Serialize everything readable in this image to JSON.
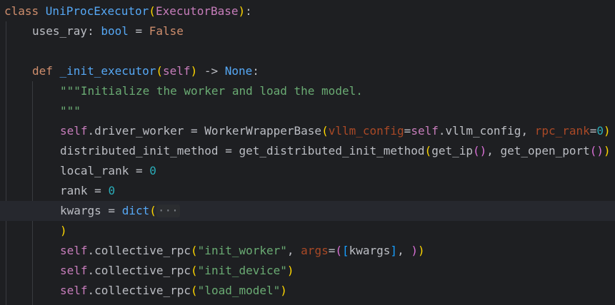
{
  "editor": {
    "lines": [
      [
        {
          "t": "class ",
          "c": "kw"
        },
        {
          "t": "UniProcExecutor",
          "c": "cls"
        },
        {
          "t": "(",
          "c": "p1"
        },
        {
          "t": "ExecutorBase",
          "c": "slf"
        },
        {
          "t": ")",
          "c": "p1"
        },
        {
          "t": ":",
          "c": "plain"
        }
      ],
      [
        {
          "t": "uses_ray",
          "c": "plain"
        },
        {
          "t": ": ",
          "c": "plain"
        },
        {
          "t": "bool",
          "c": "fn"
        },
        {
          "t": " = ",
          "c": "plain"
        },
        {
          "t": "False",
          "c": "kw"
        }
      ],
      [],
      [
        {
          "t": "def ",
          "c": "kw"
        },
        {
          "t": "_init_executor",
          "c": "fn"
        },
        {
          "t": "(",
          "c": "p1"
        },
        {
          "t": "self",
          "c": "slf"
        },
        {
          "t": ")",
          "c": "p1"
        },
        {
          "t": " -> ",
          "c": "plain"
        },
        {
          "t": "None",
          "c": "fn"
        },
        {
          "t": ":",
          "c": "plain"
        }
      ],
      [
        {
          "t": "\"\"\"Initialize the worker and load the model.",
          "c": "str"
        }
      ],
      [
        {
          "t": "\"\"\"",
          "c": "str"
        }
      ],
      [
        {
          "t": "self",
          "c": "slf"
        },
        {
          "t": ".driver_worker = ",
          "c": "plain"
        },
        {
          "t": "WorkerWrapperBase",
          "c": "plain"
        },
        {
          "t": "(",
          "c": "p1"
        },
        {
          "t": "vllm_config",
          "c": "kwarg"
        },
        {
          "t": "=",
          "c": "plain"
        },
        {
          "t": "self",
          "c": "slf"
        },
        {
          "t": ".vllm_config, ",
          "c": "plain"
        },
        {
          "t": "rpc_rank",
          "c": "kwarg"
        },
        {
          "t": "=",
          "c": "plain"
        },
        {
          "t": "0",
          "c": "num"
        },
        {
          "t": ")",
          "c": "p1"
        }
      ],
      [
        {
          "t": "distributed_init_method = ",
          "c": "plain"
        },
        {
          "t": "get_distributed_init_method",
          "c": "plain"
        },
        {
          "t": "(",
          "c": "p1"
        },
        {
          "t": "get_ip",
          "c": "plain"
        },
        {
          "t": "()",
          "c": "p2"
        },
        {
          "t": ", ",
          "c": "plain"
        },
        {
          "t": "get_open_port",
          "c": "plain"
        },
        {
          "t": "()",
          "c": "p2"
        },
        {
          "t": ")",
          "c": "p1"
        }
      ],
      [
        {
          "t": "local_rank = ",
          "c": "plain"
        },
        {
          "t": "0",
          "c": "num"
        }
      ],
      [
        {
          "t": "rank = ",
          "c": "plain"
        },
        {
          "t": "0",
          "c": "num"
        }
      ],
      [
        {
          "t": "kwargs = ",
          "c": "plain"
        },
        {
          "t": "dict",
          "c": "fn"
        },
        {
          "t": "(",
          "c": "p1"
        },
        {
          "t": "···",
          "c": "fold"
        }
      ],
      [
        {
          "t": ")",
          "c": "p1"
        }
      ],
      [
        {
          "t": "self",
          "c": "slf"
        },
        {
          "t": ".collective_rpc",
          "c": "plain"
        },
        {
          "t": "(",
          "c": "p1"
        },
        {
          "t": "\"init_worker\"",
          "c": "str"
        },
        {
          "t": ", ",
          "c": "plain"
        },
        {
          "t": "args",
          "c": "kwarg"
        },
        {
          "t": "=",
          "c": "plain"
        },
        {
          "t": "(",
          "c": "p2"
        },
        {
          "t": "[",
          "c": "p3"
        },
        {
          "t": "kwargs",
          "c": "plain"
        },
        {
          "t": "]",
          "c": "p3"
        },
        {
          "t": ", ",
          "c": "plain"
        },
        {
          "t": ")",
          "c": "p2"
        },
        {
          "t": ")",
          "c": "p1"
        }
      ],
      [
        {
          "t": "self",
          "c": "slf"
        },
        {
          "t": ".collective_rpc",
          "c": "plain"
        },
        {
          "t": "(",
          "c": "p1"
        },
        {
          "t": "\"init_device\"",
          "c": "str"
        },
        {
          "t": ")",
          "c": "p1"
        }
      ],
      [
        {
          "t": "self",
          "c": "slf"
        },
        {
          "t": ".collective_rpc",
          "c": "plain"
        },
        {
          "t": "(",
          "c": "p1"
        },
        {
          "t": "\"load_model\"",
          "c": "str"
        },
        {
          "t": ")",
          "c": "p1"
        }
      ]
    ]
  }
}
